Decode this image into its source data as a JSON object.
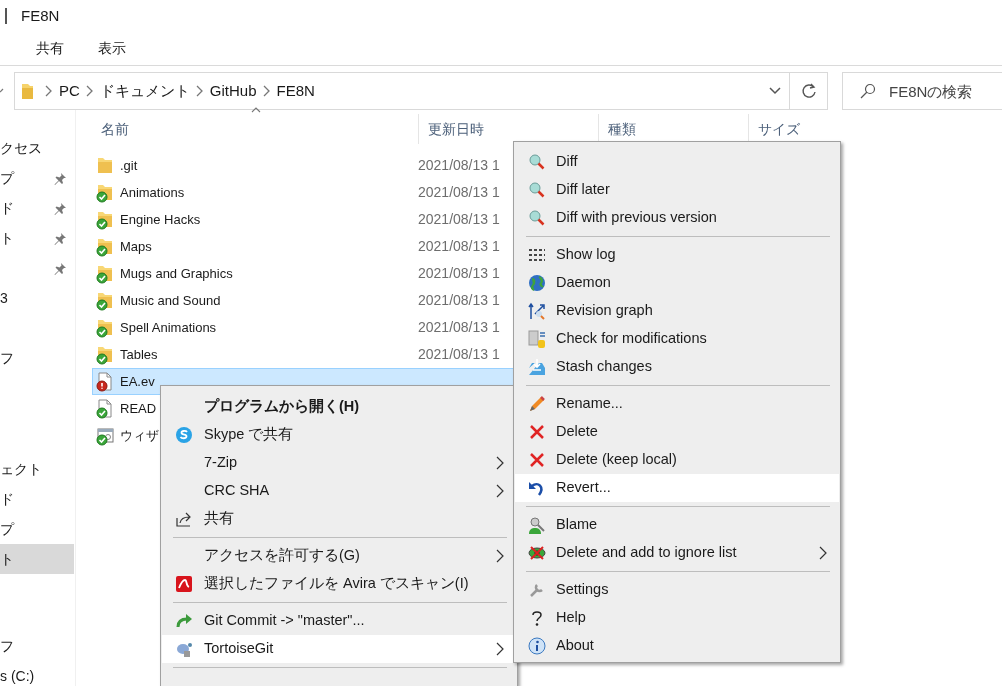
{
  "window": {
    "title": "FE8N"
  },
  "ribbon_tabs": [
    {
      "label": "共有"
    },
    {
      "label": "表示"
    }
  ],
  "address": {
    "crumbs": [
      "PC",
      "ドキュメント",
      "GitHub",
      "FE8N"
    ]
  },
  "search": {
    "placeholder": "FE8Nの検索"
  },
  "nav": {
    "groups": [
      [
        {
          "label": "クセス",
          "pinned": false,
          "selected": false
        },
        {
          "label": "プ",
          "pinned": true,
          "selected": false
        },
        {
          "label": "ド",
          "pinned": true,
          "selected": false
        },
        {
          "label": "ト",
          "pinned": true,
          "selected": false
        },
        {
          "pinned": true,
          "selected": false
        },
        {
          "label": "3",
          "pinned": false,
          "selected": false
        }
      ],
      [
        {
          "label": "フ",
          "pinned": false,
          "selected": false
        }
      ],
      [
        {
          "label": "ェクト",
          "pinned": false,
          "selected": false
        },
        {
          "label": "ド",
          "pinned": false,
          "selected": false
        },
        {
          "label": "プ",
          "pinned": false,
          "selected": false
        },
        {
          "label": "ト",
          "pinned": false,
          "selected": true
        }
      ],
      [
        {
          "label": "フ",
          "pinned": false,
          "selected": false
        },
        {
          "label": "s (C:)",
          "pinned": false,
          "selected": false
        }
      ]
    ]
  },
  "files": {
    "columns": [
      {
        "label": "名前",
        "sorted": true
      },
      {
        "label": "更新日時",
        "sorted": false
      },
      {
        "label": "種類",
        "sorted": false
      },
      {
        "label": "サイズ",
        "sorted": false
      }
    ],
    "rows": [
      {
        "name": ".git",
        "kind": "folder",
        "in_sync": false,
        "conflicted": false,
        "date": "2021/08/13 1",
        "selected": false
      },
      {
        "name": "Animations",
        "kind": "folder",
        "in_sync": true,
        "conflicted": false,
        "date": "2021/08/13 1",
        "selected": false
      },
      {
        "name": "Engine Hacks",
        "kind": "folder",
        "in_sync": true,
        "conflicted": false,
        "date": "2021/08/13 1",
        "selected": false
      },
      {
        "name": "Maps",
        "kind": "folder",
        "in_sync": true,
        "conflicted": false,
        "date": "2021/08/13 1",
        "selected": false
      },
      {
        "name": "Mugs and Graphics",
        "kind": "folder",
        "in_sync": true,
        "conflicted": false,
        "date": "2021/08/13 1",
        "selected": false
      },
      {
        "name": "Music and Sound",
        "kind": "folder",
        "in_sync": true,
        "conflicted": false,
        "date": "2021/08/13 1",
        "selected": false
      },
      {
        "name": "Spell Animations",
        "kind": "folder",
        "in_sync": true,
        "conflicted": false,
        "date": "2021/08/13 1",
        "selected": false
      },
      {
        "name": "Tables",
        "kind": "folder",
        "in_sync": true,
        "conflicted": false,
        "date": "2021/08/13 1",
        "selected": false
      },
      {
        "name": "EA.ev",
        "kind": "file",
        "in_sync": false,
        "conflicted": true,
        "selected": true
      },
      {
        "name": "READ",
        "kind": "file",
        "in_sync": true,
        "conflicted": false,
        "selected": false
      },
      {
        "name": "ウィザ",
        "kind": "wizard",
        "in_sync": true,
        "conflicted": false,
        "selected": false
      }
    ]
  },
  "menus": [
    {
      "items": [
        {
          "kind": "item",
          "label": "プログラムから開く(H)",
          "default": true,
          "submenu": false,
          "selected": false
        },
        {
          "kind": "item",
          "label": "Skype で共有",
          "default": false,
          "submenu": false,
          "selected": false
        },
        {
          "kind": "item",
          "label": "7-Zip",
          "default": false,
          "submenu": true,
          "selected": false
        },
        {
          "kind": "item",
          "label": "CRC SHA",
          "default": false,
          "submenu": true,
          "selected": false
        },
        {
          "kind": "item",
          "label": "共有",
          "default": false,
          "submenu": false,
          "selected": false
        },
        {
          "kind": "separator"
        },
        {
          "kind": "item",
          "label": "アクセスを許可する(G)",
          "default": false,
          "submenu": true,
          "selected": false
        },
        {
          "kind": "item",
          "label": "選択したファイルを Avira でスキャン(I)",
          "default": false,
          "submenu": false,
          "selected": false
        },
        {
          "kind": "separator"
        },
        {
          "kind": "item",
          "label": "Git Commit -> \"master\"...",
          "default": false,
          "submenu": false,
          "selected": false
        },
        {
          "kind": "item",
          "label": "TortoiseGit",
          "default": false,
          "submenu": true,
          "selected": true
        },
        {
          "kind": "separator"
        }
      ]
    },
    {
      "items": [
        {
          "kind": "item",
          "label": "Diff",
          "submenu": false,
          "selected": false
        },
        {
          "kind": "item",
          "label": "Diff later",
          "submenu": false,
          "selected": false
        },
        {
          "kind": "item",
          "label": "Diff with previous version",
          "submenu": false,
          "selected": false
        },
        {
          "kind": "separator"
        },
        {
          "kind": "item",
          "label": "Show log",
          "submenu": false,
          "selected": false
        },
        {
          "kind": "item",
          "label": "Daemon",
          "submenu": false,
          "selected": false
        },
        {
          "kind": "item",
          "label": "Revision graph",
          "submenu": false,
          "selected": false
        },
        {
          "kind": "item",
          "label": "Check for modifications",
          "submenu": false,
          "selected": false
        },
        {
          "kind": "item",
          "label": "Stash changes",
          "submenu": false,
          "selected": false
        },
        {
          "kind": "separator"
        },
        {
          "kind": "item",
          "label": "Rename...",
          "submenu": false,
          "selected": false
        },
        {
          "kind": "item",
          "label": "Delete",
          "submenu": false,
          "selected": false
        },
        {
          "kind": "item",
          "label": "Delete (keep local)",
          "submenu": false,
          "selected": false
        },
        {
          "kind": "item",
          "label": "Revert...",
          "submenu": false,
          "selected": true
        },
        {
          "kind": "separator"
        },
        {
          "kind": "item",
          "label": "Blame",
          "submenu": false,
          "selected": false
        },
        {
          "kind": "item",
          "label": "Delete and add to ignore list",
          "submenu": true,
          "selected": false
        },
        {
          "kind": "separator"
        },
        {
          "kind": "item",
          "label": "Settings",
          "submenu": false,
          "selected": false
        },
        {
          "kind": "item",
          "label": "Help",
          "submenu": false,
          "selected": false
        },
        {
          "kind": "item",
          "label": "About",
          "submenu": false,
          "selected": false
        }
      ]
    }
  ]
}
